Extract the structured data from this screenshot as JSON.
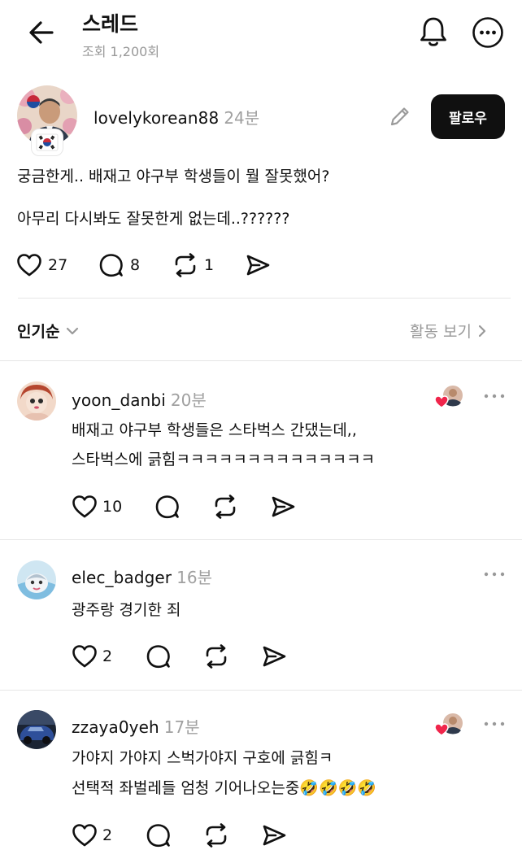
{
  "header": {
    "title": "스레드",
    "views": "조회 1,200회"
  },
  "post": {
    "username": "lovelykorean88",
    "time": "24분",
    "follow_label": "팔로우",
    "lines": [
      "궁금한게.. 배재고 야구부 학생들이 뭘 잘못했어?",
      "아무리 다시봐도 잘못한게 없는데..??????"
    ],
    "likes": "27",
    "comments": "8",
    "reposts": "1"
  },
  "sort": {
    "label": "인기순",
    "activity_label": "활동 보기"
  },
  "replies": [
    {
      "username": "yoon_danbi",
      "time": "20분",
      "lines": [
        "배재고 야구부 학생들은 스타벅스 간댔는데,,",
        "스타벅스에 긁힘ㅋㅋㅋㅋㅋㅋㅋㅋㅋㅋㅋㅋㅋㅋ"
      ],
      "likes": "10",
      "liked_by_author": true
    },
    {
      "username": "elec_badger",
      "time": "16분",
      "lines": [
        "광주랑 경기한 죄"
      ],
      "likes": "2",
      "liked_by_author": false
    },
    {
      "username": "zzaya0yeh",
      "time": "17분",
      "lines": [
        "가야지 가야지 스벅가야지  구호에 긁힘ㅋ",
        "선택적 좌벌레들 엄청 기어나오는중🤣🤣🤣🤣"
      ],
      "likes": "2",
      "liked_by_author": true
    }
  ],
  "icons": {
    "back": "back-arrow-icon",
    "bell": "bell-icon",
    "more": "more-icon",
    "edit": "pencil-icon",
    "heart": "heart-icon",
    "comment": "comment-icon",
    "repost": "repost-icon",
    "share": "share-icon",
    "flag": "korean-flag-badge"
  },
  "colors": {
    "like_red": "#f0254b",
    "follow_bg": "#101010"
  }
}
